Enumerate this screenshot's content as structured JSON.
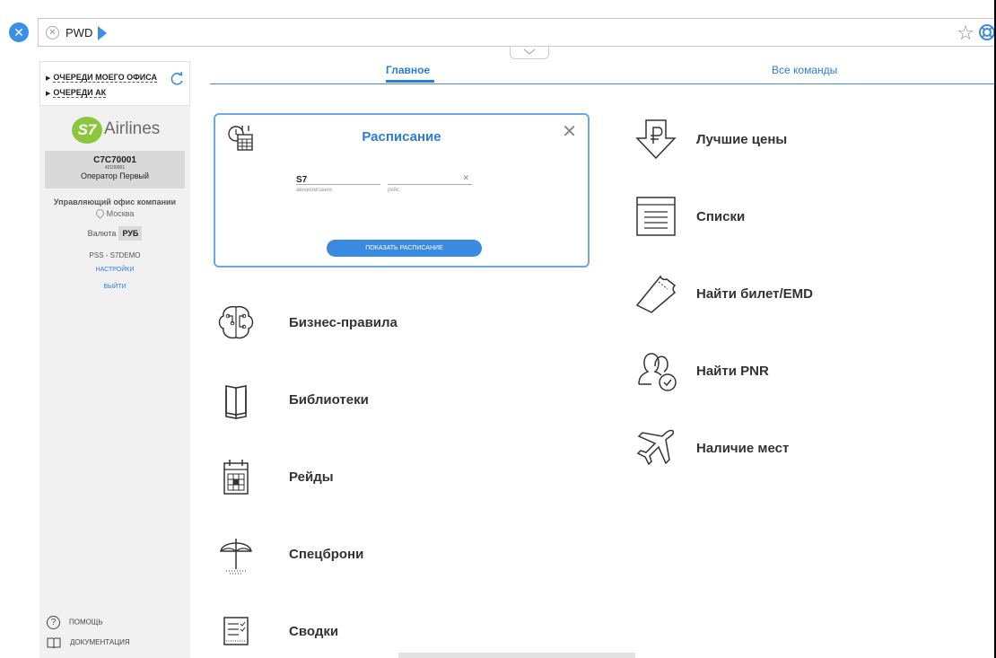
{
  "topbar": {
    "command_chip": "PWD"
  },
  "sidebar": {
    "queues": [
      "ОЧЕРЕДИ МОЕГО ОФИСА",
      "ОЧЕРЕДИ АК"
    ],
    "logo_badge": "S7",
    "logo_text": "Airlines",
    "user_code": "C7C70001",
    "user_sub": "42100001",
    "user_name": "Оператор Первый",
    "office_title": "Управляющий офис компании",
    "office_city": "Москва",
    "currency_label": "Валюта",
    "currency_code": "РУБ",
    "pss": "PSS - S7DEMO",
    "settings_link": "НАСТРОЙКИ",
    "logout_link": "ВЫЙТИ",
    "help_label": "ПОМОЩЬ",
    "docs_label": "ДОКУМЕНТАЦИЯ"
  },
  "tabs": {
    "main": "Главное",
    "all": "Все команды"
  },
  "schedule": {
    "title": "Расписание",
    "airline_value": "S7",
    "airline_label": "авиакомпания",
    "flight_value": "",
    "flight_label": "рейс",
    "button": "ПОКАЗАТЬ РАСПИСАНИЕ"
  },
  "features_left": [
    {
      "label": "Бизнес-правила",
      "icon": "brain-icon"
    },
    {
      "label": "Библиотеки",
      "icon": "book-icon"
    },
    {
      "label": "Рейды",
      "icon": "calendar-icon"
    },
    {
      "label": "Спецброни",
      "icon": "umbrella-icon"
    },
    {
      "label": "Сводки",
      "icon": "report-icon"
    }
  ],
  "features_right": [
    {
      "label": "Лучшие цены",
      "icon": "ruble-down-icon"
    },
    {
      "label": "Списки",
      "icon": "list-icon"
    },
    {
      "label": "Найти билет/EMD",
      "icon": "ticket-icon"
    },
    {
      "label": "Найти PNR",
      "icon": "passengers-icon"
    },
    {
      "label": "Наличие мест",
      "icon": "plane-icon"
    }
  ],
  "colors": {
    "accent": "#2b7ed6",
    "brand_green": "#8cc63f"
  }
}
